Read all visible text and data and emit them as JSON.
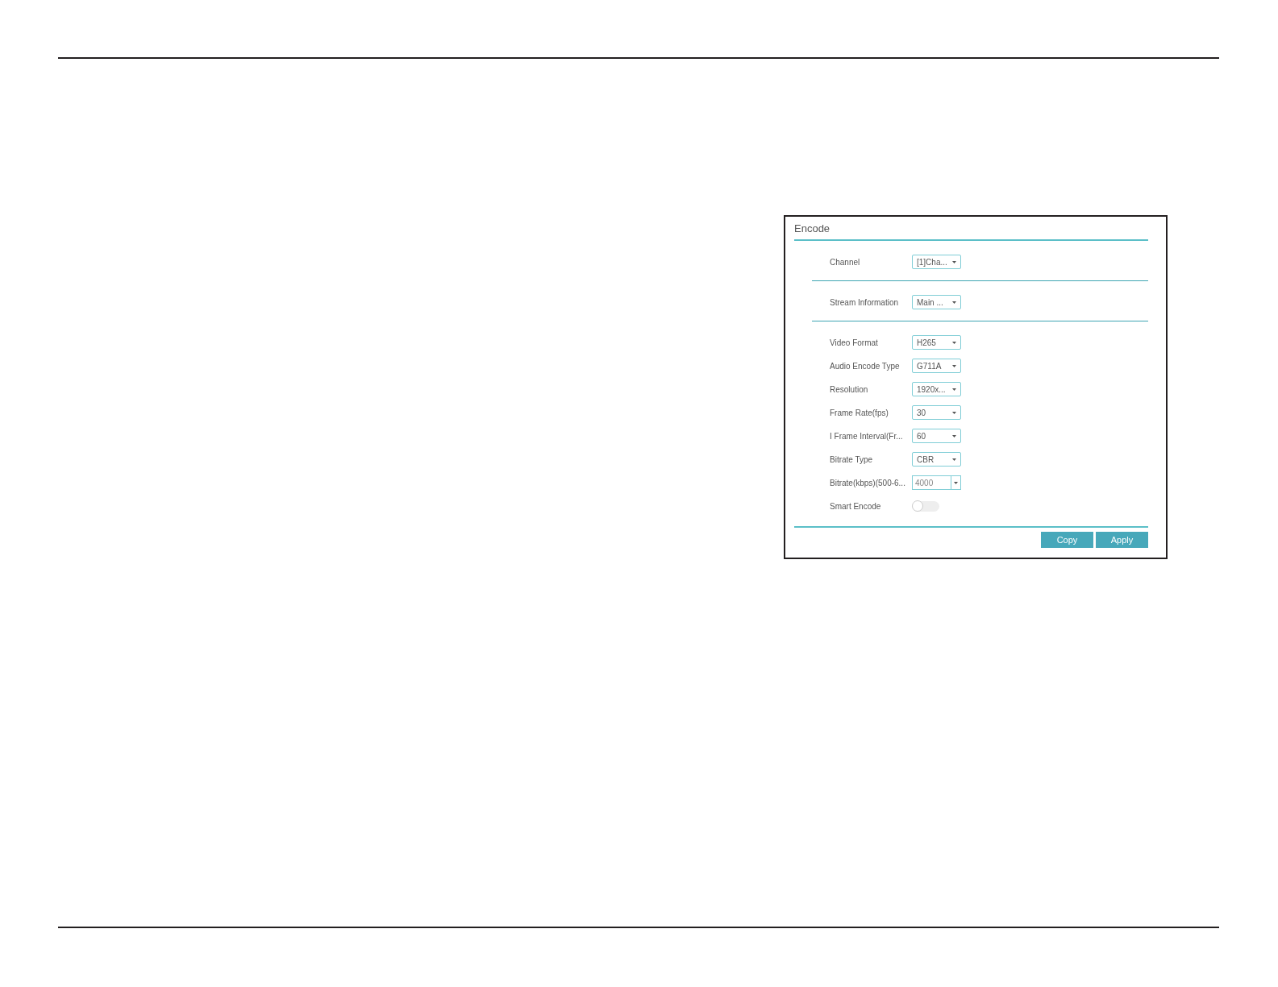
{
  "panel": {
    "title": "Encode",
    "sections": [
      {
        "fields": [
          {
            "label": "Channel",
            "kind": "select",
            "value": "[1]Cha..."
          }
        ]
      },
      {
        "fields": [
          {
            "label": "Stream Information",
            "kind": "select",
            "value": "Main ..."
          }
        ]
      },
      {
        "fields": [
          {
            "label": "Video Format",
            "kind": "select",
            "value": "H265"
          },
          {
            "label": "Audio Encode Type",
            "kind": "select",
            "value": "G711A"
          },
          {
            "label": "Resolution",
            "kind": "select",
            "value": "1920x..."
          },
          {
            "label": "Frame Rate(fps)",
            "kind": "select",
            "value": "30"
          },
          {
            "label": "I Frame Interval(Fr...",
            "kind": "select",
            "value": "60"
          },
          {
            "label": "Bitrate Type",
            "kind": "select",
            "value": "CBR"
          },
          {
            "label": "Bitrate(kbps)(500-6...",
            "kind": "combo",
            "value": "4000"
          },
          {
            "label": "Smart Encode",
            "kind": "toggle",
            "on": false
          }
        ]
      }
    ]
  },
  "buttons": [
    "Copy",
    "Apply"
  ]
}
